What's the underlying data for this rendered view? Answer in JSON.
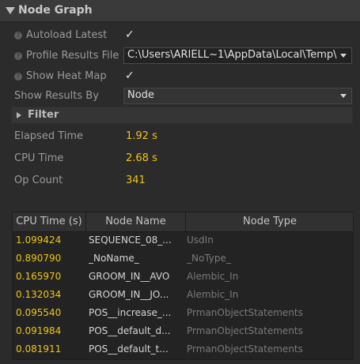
{
  "panel": {
    "title": "Node Graph"
  },
  "settings": {
    "autoload_label": "Autoload Latest",
    "autoload_checked": "✓",
    "profile_label": "Profile Results File",
    "profile_value": "C:\\Users\\ARIELL~1\\AppData\\Local\\Temp\\",
    "heatmap_label": "Show Heat Map",
    "heatmap_checked": "✓",
    "show_by_label": "Show Results By",
    "show_by_value": "Node"
  },
  "filter": {
    "label": "Filter"
  },
  "stats": {
    "elapsed_label": "Elapsed Time",
    "elapsed_value": "1.92 s",
    "cpu_label": "CPU Time",
    "cpu_value": "2.68 s",
    "op_label": "Op Count",
    "op_value": "341"
  },
  "table": {
    "headers": [
      "CPU Time (s)",
      "Node Name",
      "Node Type"
    ],
    "rows": [
      {
        "cpu": "1.099424",
        "name": "SEQUENCE_08_...",
        "type": "UsdIn"
      },
      {
        "cpu": "0.890790",
        "name": "_NoName_",
        "type": "_NoType_"
      },
      {
        "cpu": "0.165970",
        "name": "GROOM_IN__AVO",
        "type": "Alembic_In"
      },
      {
        "cpu": "0.132034",
        "name": "GROOM_IN__JO...",
        "type": "Alembic_In"
      },
      {
        "cpu": "0.095540",
        "name": "POS__increase_...",
        "type": "PrmanObjectStatements"
      },
      {
        "cpu": "0.091984",
        "name": "POS__default_d...",
        "type": "PrmanObjectStatements"
      },
      {
        "cpu": "0.081911",
        "name": "POS__default_t...",
        "type": "PrmanObjectStatements"
      }
    ]
  },
  "colors": {
    "accent": "#f0c419",
    "background": "#2b2b2b"
  }
}
